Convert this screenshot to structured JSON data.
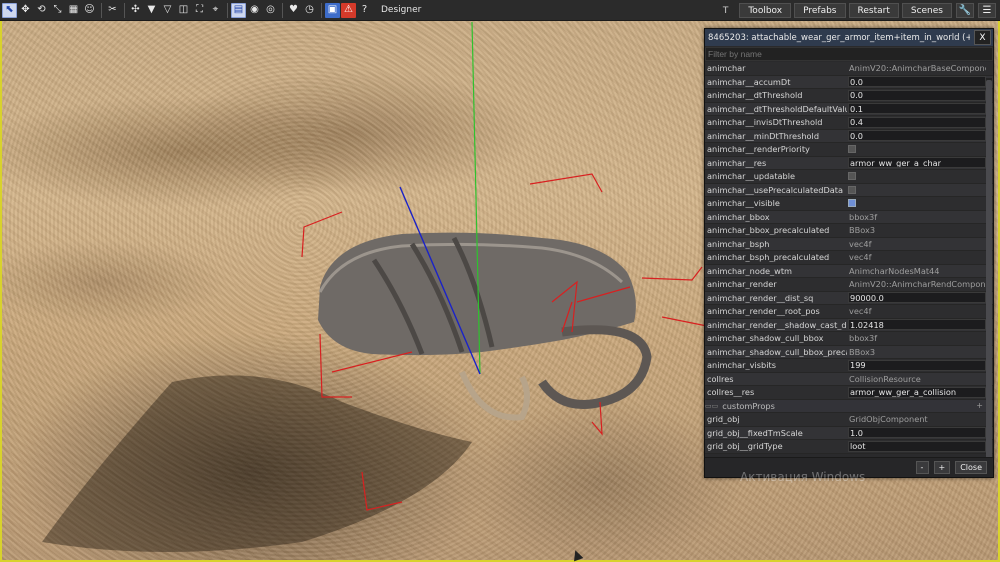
{
  "toolbar": {
    "tools": [
      "pointer-select-icon",
      "move-icon",
      "rotate-icon",
      "scale-icon",
      "grid-icon",
      "face-icon",
      "cut-icon",
      "snap-icon",
      "triangle-icon",
      "triangle-outline-icon",
      "columns-icon",
      "frame-icon",
      "target-icon",
      "page-icon",
      "eye-icon",
      "eye-alt-icon",
      "heart-icon",
      "clock-icon",
      "save-icon",
      "warning-icon",
      "help-icon"
    ],
    "mode": "Designer",
    "t_label": "T",
    "buttons": [
      "Toolbox",
      "Prefabs",
      "Restart",
      "Scenes"
    ],
    "wrench_icon": "wrench-icon",
    "menu_icon": "menu-icon"
  },
  "panel": {
    "title": "8465203: attachable_wear_ger_armor_item+item_in_world (+visibility_t",
    "close": "X",
    "filter_placeholder": "Filter by name",
    "rows": [
      {
        "name": "animchar",
        "value": "AnimV20::AnimcharBaseComponent",
        "kind": "text"
      },
      {
        "name": "animchar__accumDt",
        "value": "0.0",
        "kind": "input"
      },
      {
        "name": "animchar__dtThreshold",
        "value": "0.0",
        "kind": "input"
      },
      {
        "name": "animchar__dtThresholdDefaultValue",
        "value": "0.1",
        "kind": "input"
      },
      {
        "name": "animchar__invisDtThreshold",
        "value": "0.4",
        "kind": "input"
      },
      {
        "name": "animchar__minDtThreshold",
        "value": "0.0",
        "kind": "input"
      },
      {
        "name": "animchar__renderPriority",
        "value": "",
        "kind": "check"
      },
      {
        "name": "animchar__res",
        "value": "armor_ww_ger_a_char",
        "kind": "input"
      },
      {
        "name": "animchar__updatable",
        "value": "",
        "kind": "check"
      },
      {
        "name": "animchar__usePrecalculatedData",
        "value": "",
        "kind": "check"
      },
      {
        "name": "animchar__visible",
        "value": "",
        "kind": "check-on"
      },
      {
        "name": "animchar_bbox",
        "value": "bbox3f",
        "kind": "text"
      },
      {
        "name": "animchar_bbox_precalculated",
        "value": "BBox3",
        "kind": "text"
      },
      {
        "name": "animchar_bsph",
        "value": "vec4f",
        "kind": "text"
      },
      {
        "name": "animchar_bsph_precalculated",
        "value": "vec4f",
        "kind": "text"
      },
      {
        "name": "animchar_node_wtm",
        "value": "AnimcharNodesMat44",
        "kind": "text"
      },
      {
        "name": "animchar_render",
        "value": "AnimV20::AnimcharRendComponent",
        "kind": "text"
      },
      {
        "name": "animchar_render__dist_sq",
        "value": "90000.0",
        "kind": "input"
      },
      {
        "name": "animchar_render__root_pos",
        "value": "vec4f",
        "kind": "text"
      },
      {
        "name": "animchar_render__shadow_cast_dist",
        "value": "1.02418",
        "kind": "input"
      },
      {
        "name": "animchar_shadow_cull_bbox",
        "value": "bbox3f",
        "kind": "text"
      },
      {
        "name": "animchar_shadow_cull_bbox_precalc",
        "value": "BBox3",
        "kind": "text"
      },
      {
        "name": "animchar_visbits",
        "value": "199",
        "kind": "input"
      },
      {
        "name": "collres",
        "value": "CollisionResource",
        "kind": "text"
      },
      {
        "name": "collres__res",
        "value": "armor_ww_ger_a_collision",
        "kind": "input"
      },
      {
        "name": "customProps",
        "value": "+",
        "kind": "section"
      },
      {
        "name": "grid_obj",
        "value": "GridObjComponent",
        "kind": "text"
      },
      {
        "name": "grid_obj__fixedTmScale",
        "value": "1.0",
        "kind": "input"
      },
      {
        "name": "grid_obj__gridType",
        "value": "loot",
        "kind": "input"
      }
    ],
    "footer": [
      "-",
      "+",
      "Close"
    ]
  },
  "watermark": "Активация Windows",
  "colors": {
    "gizmo_red": "#d82020",
    "axis_green": "#2ec22e",
    "axis_blue": "#1a22c8",
    "highlight_border": "#d8d22c"
  }
}
